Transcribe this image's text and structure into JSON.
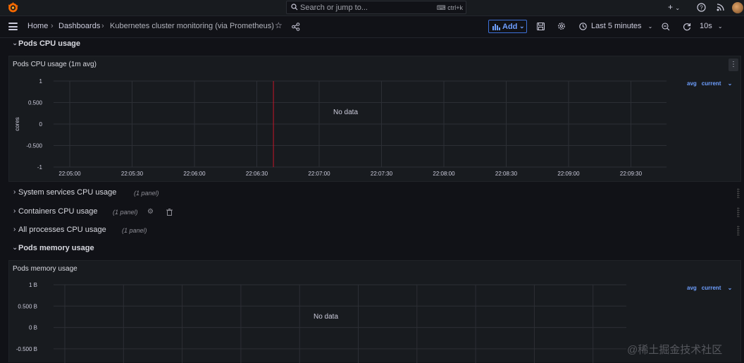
{
  "topbar": {
    "search_placeholder": "Search or jump to...",
    "search_shortcut": "ctrl+k",
    "plus_label": "+",
    "help_icon": "help-icon",
    "news_icon": "rss-icon"
  },
  "navbar": {
    "breadcrumbs": [
      "Home",
      "Dashboards",
      "Kubernetes cluster monitoring (via Prometheus)"
    ],
    "add_label": "Add",
    "time_range": "Last 5 minutes",
    "refresh_interval": "10s"
  },
  "colors": {
    "accent": "#6e9fff",
    "background": "#111217",
    "panel": "#181b1f",
    "annotation": "#c4162a"
  },
  "rows": [
    {
      "title": "Pods CPU usage",
      "expanded": true,
      "panel_count": ""
    },
    {
      "title": "System services CPU usage",
      "expanded": false,
      "panel_count": "(1 panel)"
    },
    {
      "title": "Containers CPU usage",
      "expanded": false,
      "panel_count": "(1 panel)"
    },
    {
      "title": "All processes CPU usage",
      "expanded": false,
      "panel_count": "(1 panel)"
    },
    {
      "title": "Pods memory usage",
      "expanded": true,
      "panel_count": ""
    }
  ],
  "panels": [
    {
      "title": "Pods CPU usage (1m avg)",
      "no_data": "No data",
      "y_axis_label": "cores",
      "y_ticks": [
        "1",
        "0.500",
        "0",
        "-0.500",
        "-1"
      ],
      "x_ticks": [
        "22:05:00",
        "22:05:30",
        "22:06:00",
        "22:06:30",
        "22:07:00",
        "22:07:30",
        "22:08:00",
        "22:08:30",
        "22:09:00",
        "22:09:30"
      ],
      "legend": [
        "avg",
        "current"
      ]
    },
    {
      "title": "Pods memory usage",
      "no_data": "No data",
      "y_ticks": [
        "1 B",
        "0.500 B",
        "0 B",
        "-0.500 B"
      ],
      "legend": [
        "avg",
        "current"
      ]
    }
  ],
  "chart_data": [
    {
      "type": "line",
      "title": "Pods CPU usage (1m avg)",
      "ylabel": "cores",
      "xlabel": "",
      "ylim": [
        -1,
        1
      ],
      "y_ticks": [
        1,
        0.5,
        0,
        -0.5,
        -1
      ],
      "x": [
        "22:05:00",
        "22:05:30",
        "22:06:00",
        "22:06:30",
        "22:07:00",
        "22:07:30",
        "22:08:00",
        "22:08:30",
        "22:09:00",
        "22:09:30"
      ],
      "series": [],
      "annotation_time": "22:06:38",
      "grid": true,
      "legend": "top-right"
    },
    {
      "type": "line",
      "title": "Pods memory usage",
      "ylabel": "",
      "xlabel": "",
      "ylim": [
        -0.5,
        1
      ],
      "y_ticks": [
        "1 B",
        "0.500 B",
        "0 B",
        "-0.500 B"
      ],
      "series": [],
      "grid": true,
      "legend": "top-right"
    }
  ],
  "watermark": "@稀土掘金技术社区"
}
